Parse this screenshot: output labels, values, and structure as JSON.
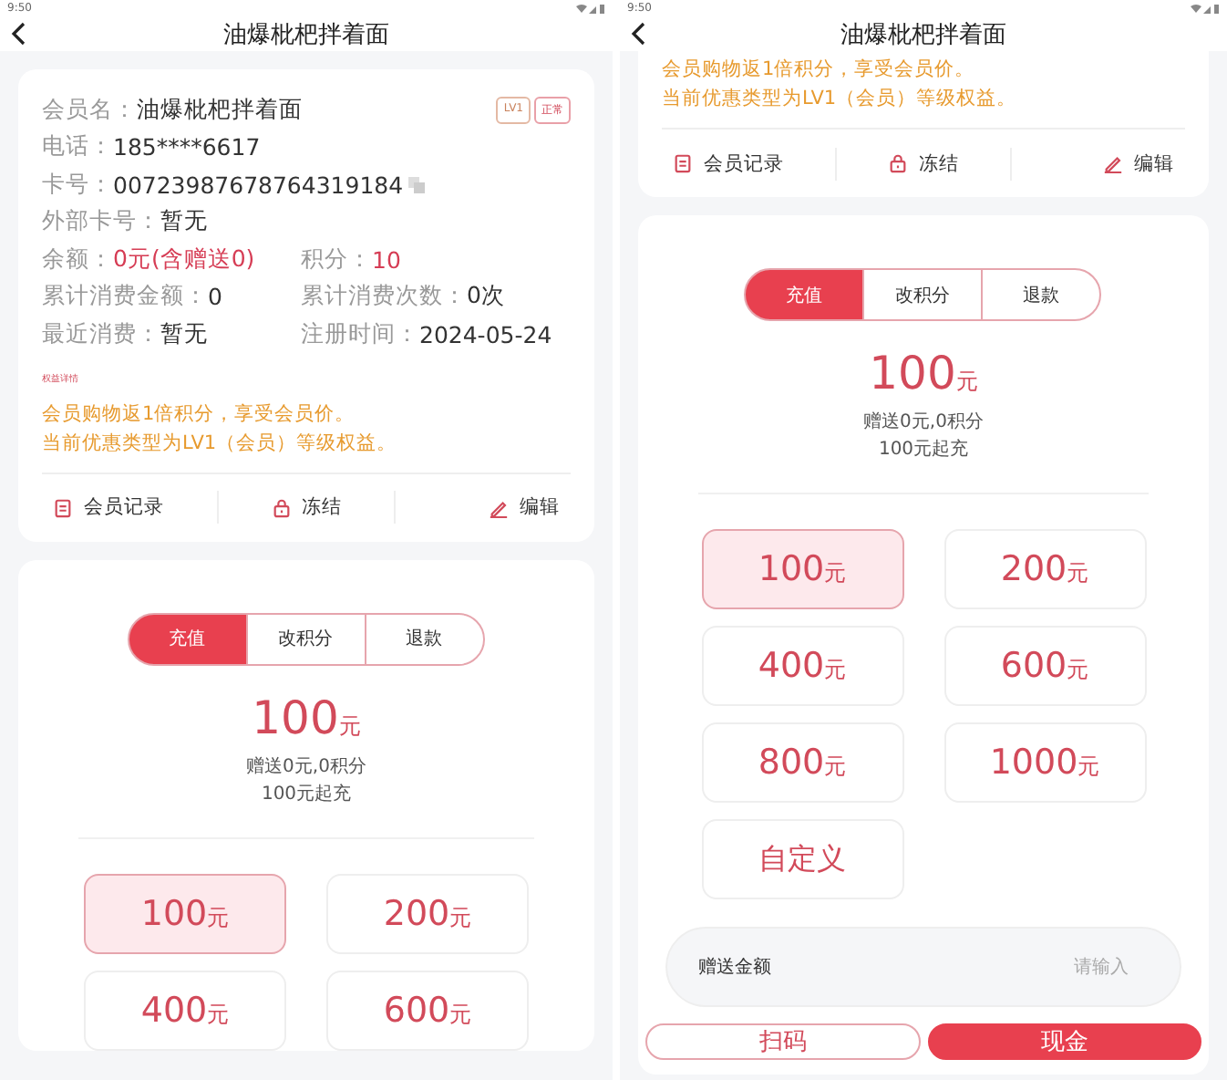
{
  "screens": [
    {
      "status_time": "9:50",
      "title": "油爆枇杷拌着面",
      "member": {
        "badges": [
          {
            "label": "LV1",
            "kind": "level"
          },
          {
            "label": "正常",
            "kind": "status"
          }
        ],
        "fields": [
          [
            {
              "label": "会员名：",
              "value": "油爆枇杷拌着面",
              "highlight": false,
              "copy": false
            }
          ],
          [
            {
              "label": "电话：",
              "value": "185****6617",
              "highlight": false,
              "copy": false
            }
          ],
          [
            {
              "label": "卡号：",
              "value": "00723987678764319184",
              "highlight": false,
              "copy": true
            }
          ],
          [
            {
              "label": "外部卡号：",
              "value": "暂无",
              "highlight": false,
              "copy": false
            }
          ],
          [
            {
              "label": "余额：",
              "value": "0元(含赠送0)",
              "highlight": true,
              "copy": false
            },
            {
              "label": "积分：",
              "value": "10",
              "highlight": true,
              "copy": false
            }
          ],
          [
            {
              "label": "累计消费金额：",
              "value": "0",
              "highlight": false,
              "copy": false
            },
            {
              "label": "累计消费次数：",
              "value": "0次",
              "highlight": false,
              "copy": false
            }
          ],
          [
            {
              "label": "最近消费：",
              "value": "暂无",
              "highlight": false,
              "copy": false
            },
            {
              "label": "注册时间：",
              "value": "2024-05-24",
              "highlight": false,
              "copy": false
            }
          ]
        ],
        "benefits_link": "权益详情",
        "notes": [
          "会员购物返1倍积分，享受会员价。",
          "当前优惠类型为LV1（会员）等级权益。"
        ],
        "actions": [
          {
            "label": "会员记录"
          },
          {
            "label": "冻结"
          },
          {
            "label": "编辑"
          }
        ]
      },
      "recharge": {
        "tabs": [
          {
            "label": "充值",
            "selected": true
          },
          {
            "label": "改积分",
            "selected": false
          },
          {
            "label": "退款",
            "selected": false
          }
        ],
        "amount": "100",
        "unit": "元",
        "lines": [
          "赠送0元,0积分",
          "100元起充"
        ],
        "options": [
          {
            "kind": "amount",
            "amount": "100",
            "unit": "元",
            "selected": true
          },
          {
            "kind": "amount",
            "amount": "200",
            "unit": "元",
            "selected": false
          },
          {
            "kind": "amount",
            "amount": "400",
            "unit": "元",
            "selected": false
          },
          {
            "kind": "amount",
            "amount": "600",
            "unit": "元",
            "selected": false
          }
        ]
      }
    },
    {
      "status_time": "9:50",
      "title": "油爆枇杷拌着面",
      "member": {
        "notes": [
          "会员购物返1倍积分，享受会员价。",
          "当前优惠类型为LV1（会员）等级权益。"
        ],
        "actions": [
          {
            "label": "会员记录"
          },
          {
            "label": "冻结"
          },
          {
            "label": "编辑"
          }
        ]
      },
      "recharge": {
        "tabs": [
          {
            "label": "充值",
            "selected": true
          },
          {
            "label": "改积分",
            "selected": false
          },
          {
            "label": "退款",
            "selected": false
          }
        ],
        "amount": "100",
        "unit": "元",
        "lines": [
          "赠送0元,0积分",
          "100元起充"
        ],
        "options": [
          {
            "kind": "amount",
            "amount": "100",
            "unit": "元",
            "selected": true
          },
          {
            "kind": "amount",
            "amount": "200",
            "unit": "元",
            "selected": false
          },
          {
            "kind": "amount",
            "amount": "400",
            "unit": "元",
            "selected": false
          },
          {
            "kind": "amount",
            "amount": "600",
            "unit": "元",
            "selected": false
          },
          {
            "kind": "amount",
            "amount": "800",
            "unit": "元",
            "selected": false
          },
          {
            "kind": "amount",
            "amount": "1000",
            "unit": "元",
            "selected": false
          },
          {
            "kind": "custom",
            "label": "自定义",
            "selected": false
          }
        ],
        "gift_field": {
          "label": "赠送金额",
          "placeholder": "请输入"
        },
        "payment_buttons": [
          {
            "label": "扫码",
            "primary": false
          },
          {
            "label": "现金",
            "primary": true
          }
        ]
      }
    }
  ]
}
